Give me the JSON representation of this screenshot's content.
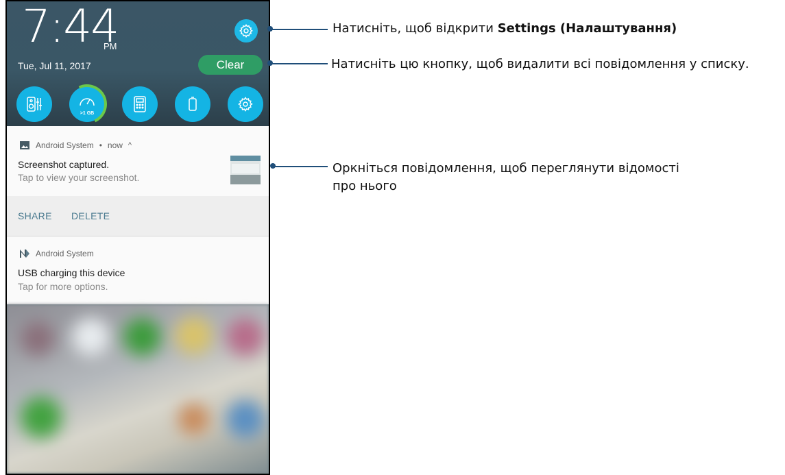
{
  "status": {
    "time": "7:44",
    "ampm": "PM",
    "date": "Tue, Jul 11, 2017"
  },
  "header": {
    "clear_label": "Clear"
  },
  "quick_settings": {
    "tiles": [
      {
        "icon": "audio-wizard-icon"
      },
      {
        "icon": "boost-icon",
        "memory": ">1 GB"
      },
      {
        "icon": "calculator-icon"
      },
      {
        "icon": "battery-icon"
      },
      {
        "icon": "settings-icon"
      }
    ]
  },
  "notifications": [
    {
      "app": "Android System",
      "meta": "now",
      "title": "Screenshot captured.",
      "text": "Tap to view your screenshot.",
      "actions": [
        "SHARE",
        "DELETE"
      ]
    },
    {
      "app": "Android System",
      "title": "USB charging this device",
      "text": "Tap for more options."
    }
  ],
  "annotations": {
    "settings_prefix": "Натисніть, щоб відкрити ",
    "settings_bold": "Settings (Налаштування)",
    "clear": "Натисніть цю кнопку, щоб видалити всі повідомлення у списку.",
    "notification_line1": "Оркніться повідомлення, щоб переглянути відомості",
    "notification_line2": "про нього"
  },
  "colors": {
    "tile": "#14b4e4",
    "clear_button": "#2f9d65",
    "annotation_line": "#1f4e79",
    "shade": "#3a5766"
  }
}
